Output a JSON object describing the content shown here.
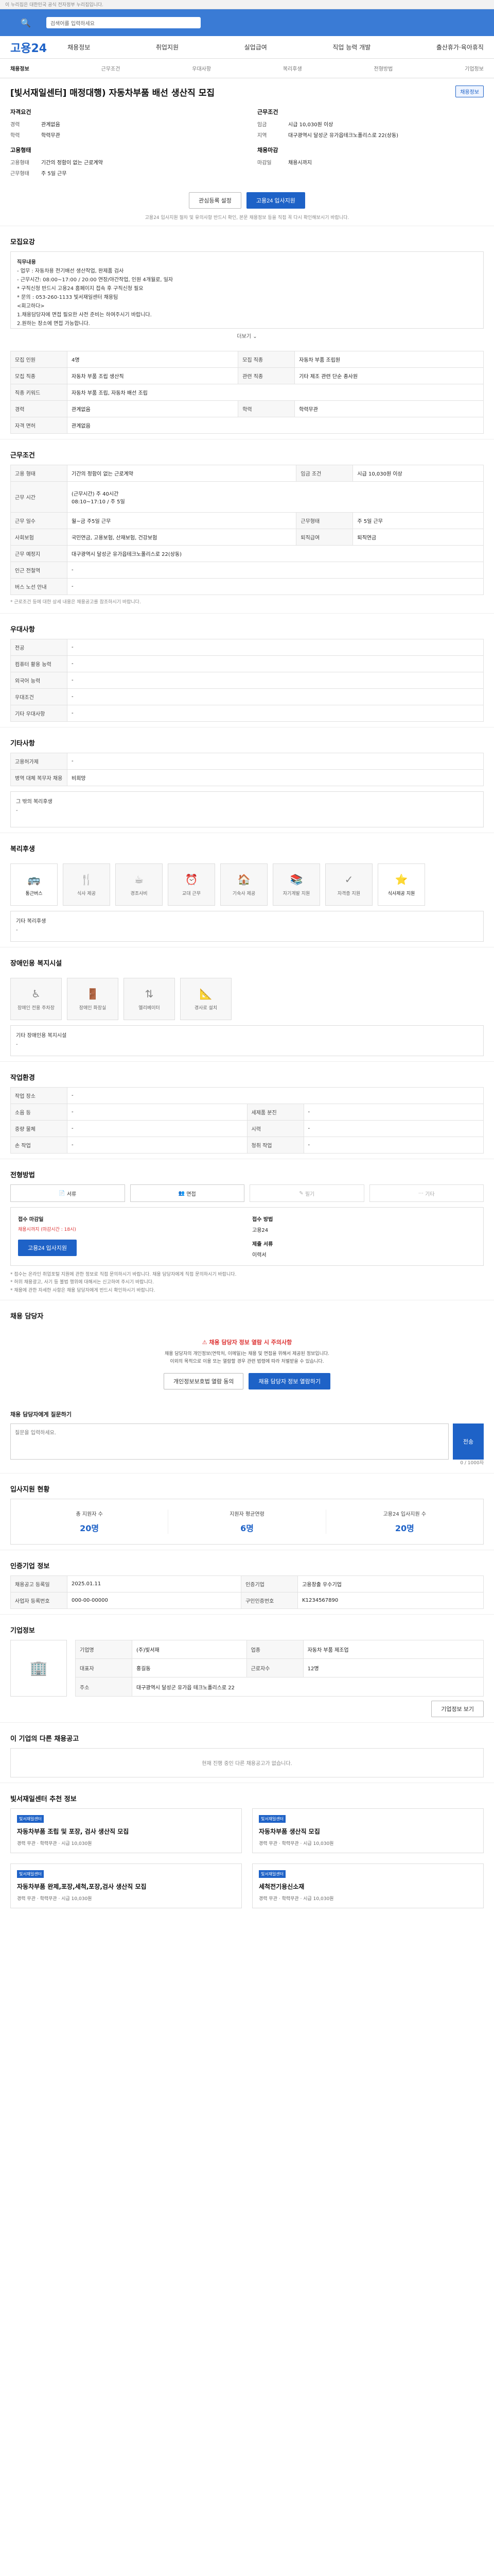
{
  "topbar": {
    "text": "이 누리집은 대한민국 공식 전자정부 누리집입니다."
  },
  "search": {
    "placeholder": "검색어를 입력하세요"
  },
  "gnb": {
    "logo": "고용24",
    "menu": [
      "채용정보",
      "취업지원",
      "실업급여",
      "직업 능력 개발",
      "출산휴가·육아휴직"
    ]
  },
  "subnav": [
    "채용정보",
    "근무조건",
    "우대사항",
    "복리후생",
    "전형방법",
    "기업정보"
  ],
  "job": {
    "title": "[빛서재일센터] 매정대행) 자동차부품 배선 생산직 모집",
    "tag": "채용정보",
    "qualification_head": "자격요건",
    "qual_rows": [
      {
        "k": "경력",
        "v": "관계없음"
      },
      {
        "k": "학력",
        "v": "학력무관"
      }
    ],
    "condition_head": "근무조건",
    "cond_rows": [
      {
        "k": "임금",
        "v": "시급 10,030원 이상"
      },
      {
        "k": "지역",
        "v": "대구광역시 달성군 유가읍테크노폴리스로 22(상동)"
      }
    ],
    "employ_head": "고용형태",
    "employ_rows": [
      {
        "k": "고용형태",
        "v": "기간의 정함이 없는 근로계약"
      },
      {
        "k": "근무형태",
        "v": "주 5일 근무"
      }
    ],
    "deadline_head": "채용마감",
    "deadline_rows": [
      {
        "k": "마감일",
        "v": "채용시까지"
      }
    ]
  },
  "buttons": {
    "interest": "관심등록 설정",
    "apply": "고용24 입사지원",
    "notice": "고용24 입사지원 절차 및 유의사항 반드시 확인, 본문 채용정보 등을 직접 꼭 다시 확인해보시기 바랍니다."
  },
  "sections": {
    "detail": "모집요강",
    "desc_lines": [
      "직무내용",
      "- 업무 : 자동차용 전기배선 생산작업, 완제품 검사",
      "- 근무시간: 08:00~17:00 / 20:00 연장/야간작업, 인원 4개월로, 일자",
      "",
      "* 구직신청 반드시 고용24 홈페이지 접속 후 구직신청 필요",
      "* 문의 : 053-260-1133 빛서재일센터 채용팀",
      "",
      "<회고하다>",
      "1.채용담당자에 면접 필요한 사전 준비는 하여주시기 바랍니다.",
      "2.원하는 장소에 면접 가능합니다."
    ],
    "more": "더보기",
    "work_rows": [
      {
        "h": "모집 인원",
        "v": "4명",
        "h2": "모집 직종",
        "v2": "자동차 부품 조립원"
      },
      {
        "h": "모집 직종",
        "v": "자동차 부품 조립 생산직",
        "h2": "관련 직종",
        "v2": "기타 제조 관련 단순 종사원"
      },
      {
        "h": "직종 키워드",
        "v": "자동차 부품 조립, 자동차 배선 조립"
      },
      {
        "h": "경력",
        "v": "관계없음",
        "h2": "학력",
        "v2": "학력무관"
      },
      {
        "h": "자격 면허",
        "v": "관계없음"
      }
    ],
    "condition_title": "근무조건",
    "condition_rows": [
      {
        "h": "고용 형태",
        "v": "기간의 정함이 없는 근로계약",
        "h2": "임금 조건",
        "v2": "시급 10,030원 이상"
      },
      {
        "h": "근무 시간",
        "v": "(근무시간) 주 40시간\n08:10~17:10 / 주 5일",
        "h2": "",
        "v2": ""
      },
      {
        "h": "근무 일수",
        "v": "월~금 주5일 근무",
        "h2": "근무형태",
        "v2": "주 5일 근무"
      },
      {
        "h": "사회보험",
        "v": "국민연금, 고용보험, 산재보험, 건강보험",
        "h2": "퇴직급여",
        "v2": "퇴직연금"
      },
      {
        "h": "근무 예정지",
        "v": "대구광역시 달성군 유가읍테크노폴리스로 22(상동)"
      },
      {
        "h": "인근 전철역",
        "v": "-"
      },
      {
        "h": "버스 노선 안내",
        "v": "-"
      }
    ],
    "condition_note": "* 근로조건 등에 대한 상세 내용은 채용공고를 참조하시기 바랍니다.",
    "pref_title": "우대사항",
    "pref_rows": [
      {
        "h": "전공",
        "v": "-"
      },
      {
        "h": "컴퓨터 활용 능력",
        "v": "-"
      },
      {
        "h": "외국어 능력",
        "v": "-"
      },
      {
        "h": "우대조건",
        "v": "-"
      },
      {
        "h": "기타 우대사항",
        "v": "-"
      }
    ],
    "etc_title": "기타사항",
    "etc_rows": [
      {
        "h": "고용허가제",
        "v": "-"
      },
      {
        "h": "병역 대체 복무자 채용",
        "v": "비희망"
      }
    ],
    "etc_note": "그 밖의 복리후생",
    "etc_empty": "-",
    "welfare_title": "복리후생",
    "welfare_items": [
      {
        "icon": "🚌",
        "label": "통근버스"
      },
      {
        "icon": "🍴",
        "label": "식사 제공"
      },
      {
        "icon": "☕",
        "label": "경조사비"
      },
      {
        "icon": "⏰",
        "label": "교대 근무"
      },
      {
        "icon": "🏠",
        "label": "기숙사 제공"
      },
      {
        "icon": "📚",
        "label": "자기계발 지원"
      },
      {
        "icon": "✓",
        "label": "자격증 지원"
      },
      {
        "icon": "⭐",
        "label": "식사제공 지원"
      }
    ],
    "welfare_etc_label": "기타 복리후생",
    "welfare_etc_value": "-",
    "disability_title": "장애인용 복지시설",
    "disability_items": [
      {
        "icon": "♿",
        "label": "장애인 전용 주차장"
      },
      {
        "icon": "🚪",
        "label": "장애인 화장실"
      },
      {
        "icon": "⇅",
        "label": "엘리베이터"
      },
      {
        "icon": "📐",
        "label": "경사로 설치"
      }
    ],
    "disability_etc_label": "기타 장애인용 복지시설",
    "disability_etc_value": "-",
    "work_env_title": "작업환경",
    "env_rows": [
      {
        "h": "작업 장소",
        "v": "-"
      },
      {
        "h": "소음 등",
        "v": "-",
        "h2": "세제품 분진",
        "v2": "-"
      },
      {
        "h": "중량 물체",
        "v": "-",
        "h2": "시력",
        "v2": "-"
      },
      {
        "h": "손 작업",
        "v": "-",
        "h2": "청취 작업",
        "v2": "-"
      }
    ],
    "select_title": "전형방법",
    "methods": [
      "서류",
      "면접",
      "필기",
      "기타"
    ],
    "apply_title": "접수 마감일",
    "apply_date": "채용시까지 (마감시간 : 18시)",
    "apply_cnt_title": "접수 방법",
    "apply_cnt_val": "고용24",
    "apply_doc_title": "제출 서류",
    "apply_doc_val": "이력서",
    "apply_btn": "고용24 입사지원",
    "apply_notes": [
      "* 접수는 온라인 취업포털 지원에 관한 정보로 직접 문의하시기 바랍니다. 채용 담당자에게 직접 문의하시기 바랍니다.",
      "* 허위 채용광고, 사기 등 불법 행위에 대해서는 신고하여 주시기 바랍니다.",
      "* 채용에 관한 자세한 사항은 채용 담당자에게 반드시 확인하시기 바랍니다."
    ],
    "contact_title": "채용 담당자",
    "alert_title": "⚠ 채용 담당자 정보 열람 시 주의사항",
    "alert_lines": [
      "채용 담당자의 개인정보(연락처, 이메일)는 채용 및 면접을 위해서 제공된 정보입니다.",
      "이외의 목적으로 이용 또는 열람할 경우 관련 법령에 따라 처벌받을 수 있습니다."
    ],
    "alert_btn1": "개인정보보호법 열람 동의",
    "alert_btn2": "채용 담당자 정보 열람하기",
    "inquiry_title": "채용 담당자에게 질문하기",
    "inquiry_placeholder": "질문을 입력하세요.",
    "inquiry_send": "전송",
    "inquiry_note": "0 / 1000자",
    "stats_title": "입사지원 현황",
    "stats": [
      {
        "label": "총 지원자 수",
        "value": "20명"
      },
      {
        "label": "지원자 평균연령",
        "value": "6명"
      },
      {
        "label": "고용24 입사지원 수",
        "value": "20명"
      }
    ],
    "company_title": "인증기업 정보",
    "company_rows": [
      {
        "h": "채용공고 등록일",
        "v": "2025.01.11",
        "h2": "인증기업",
        "v2": "고용창출 우수기업"
      },
      {
        "h": "사업자 등록번호",
        "v": "000-00-00000",
        "h2": "구인인증번호",
        "v2": "K1234567890"
      }
    ],
    "biz_title": "기업정보",
    "biz_rows": [
      {
        "h": "기업명",
        "v": "(주)빛서재",
        "h2": "업종",
        "v2": "자동차 부품 제조업"
      },
      {
        "h": "대표자",
        "v": "홍길동",
        "h2": "근로자수",
        "v2": "12명"
      },
      {
        "h": "주소",
        "v": "대구광역시 달성군 유가읍 테크노폴리스로 22",
        "h2": "",
        "v2": ""
      }
    ],
    "biz_view_btn": "기업정보 보기",
    "related_title": "이 기업의 다른 채용공고",
    "related_empty": "현재 진행 중인 다른 채용공고가 없습니다.",
    "recommend_title": "빛서재일센터 추천 정보",
    "recommend": [
      {
        "badge": "빛서재일센터",
        "title": "자동차부품 조립 및 포장, 검사 생산직 모집",
        "meta": "경력 무관 · 학력무관 · 시급 10,030원"
      },
      {
        "badge": "빛서재일센터",
        "title": "자동차부품 생산직 모집",
        "meta": "경력 무관 · 학력무관 · 시급 10,030원"
      },
      {
        "badge": "빛서재일센터",
        "title": "자동차부품 완제,포장,세척,포장,검사 생산직 모집",
        "meta": "경력 무관 · 학력무관 · 시급 10,030원"
      },
      {
        "badge": "빛서재일센터",
        "title": "세척전기용신소재",
        "meta": "경력 무관 · 학력무관 · 시급 10,030원"
      }
    ]
  }
}
